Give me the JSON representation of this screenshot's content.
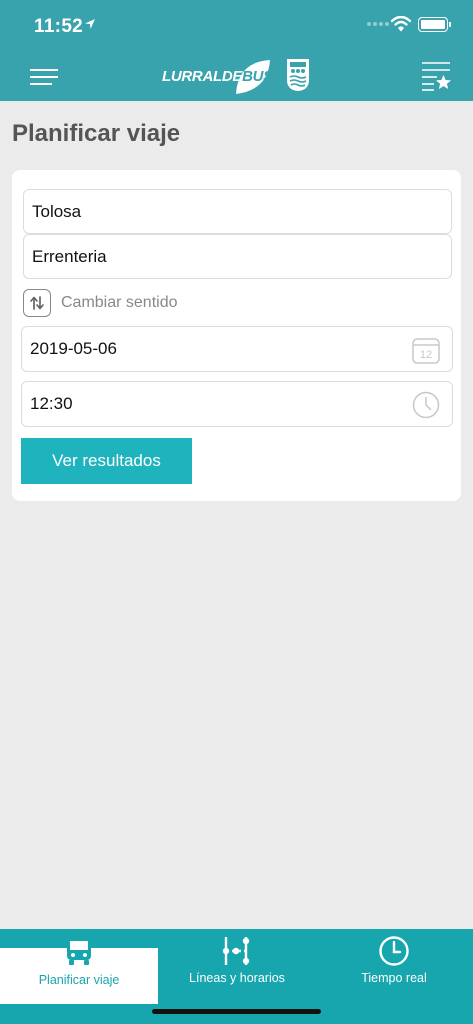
{
  "status_bar": {
    "time": "11:52"
  },
  "header": {
    "logo_text": "LURRALDE",
    "logo_text_suffix": "BUS",
    "menu_icon": "hamburger-icon",
    "favorites_icon": "favorites-list-icon",
    "brand_color": "#38a3ad"
  },
  "page": {
    "title": "Planificar viaje"
  },
  "form": {
    "origin": "Tolosa",
    "destination": "Errenteria",
    "swap_label": "Cambiar sentido",
    "date": "2019-05-06",
    "date_icon_day": "12",
    "time": "12:30",
    "submit_label": "Ver resultados",
    "accent_color": "#1fb3bd"
  },
  "tabs": [
    {
      "label": "Planificar viaje",
      "icon": "bus-icon",
      "active": true
    },
    {
      "label": "Líneas y horarios",
      "icon": "route-lines-icon",
      "active": false
    },
    {
      "label": "Tiempo real",
      "icon": "clock-icon",
      "active": false
    }
  ]
}
